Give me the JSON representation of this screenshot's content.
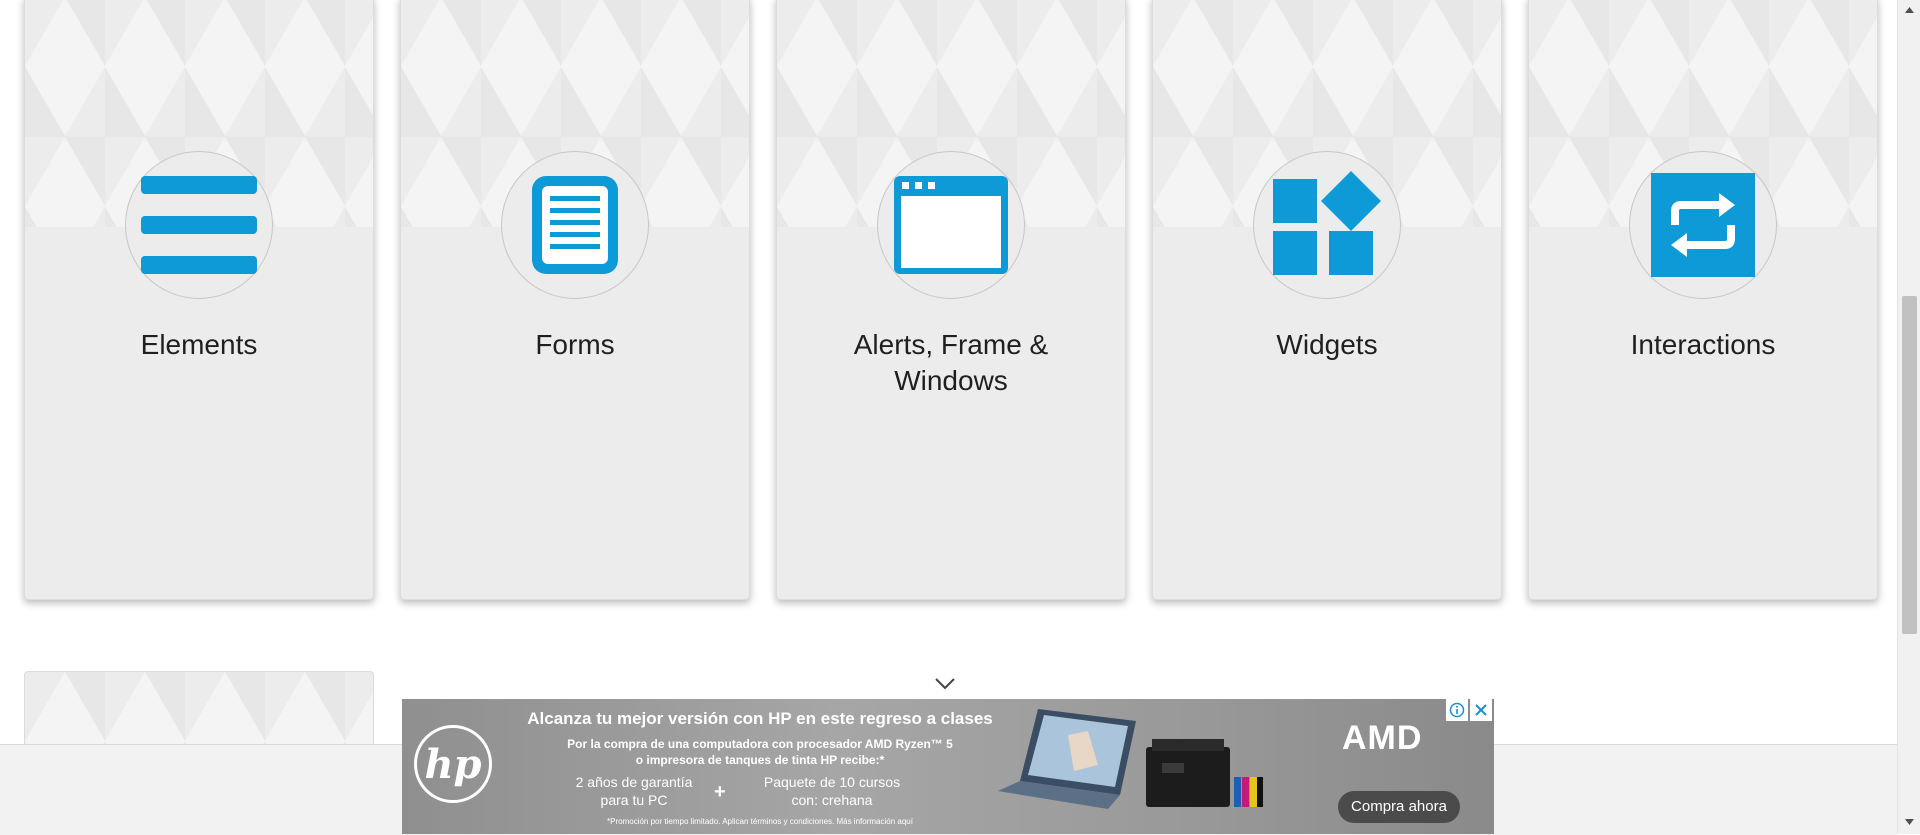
{
  "cards": [
    {
      "title": "Elements",
      "icon": "hamburger-menu-icon"
    },
    {
      "title": "Forms",
      "icon": "document-list-icon"
    },
    {
      "title": "Alerts, Frame & Windows",
      "icon": "browser-window-icon"
    },
    {
      "title": "Widgets",
      "icon": "widgets-blocks-icon"
    },
    {
      "title": "Interactions",
      "icon": "repeat-arrows-icon"
    }
  ],
  "ad": {
    "headline": "Alcanza tu mejor versión con HP en este regreso a clases",
    "sub_line1": "Por la compra de una computadora con procesador AMD Ryzen™ 5",
    "sub_line2": "o impresora de tanques de tinta HP recibe:*",
    "offer1_line1": "2 años de garantía",
    "offer1_line2": "para tu PC",
    "plus": "+",
    "offer2_line1": "Paquete de 10 cursos",
    "offer2_line2": "con: crehana",
    "fine_print": "*Promoción por tiempo limitado. Aplican términos y condiciones. Más información aquí",
    "hp_logo": "hp",
    "amd_logo": "AMD",
    "cta": "Compra ahora"
  },
  "colors": {
    "icon_blue": "#0e9ad7",
    "card_bg": "#ececec",
    "ad_bg": "#9c9c9c"
  }
}
